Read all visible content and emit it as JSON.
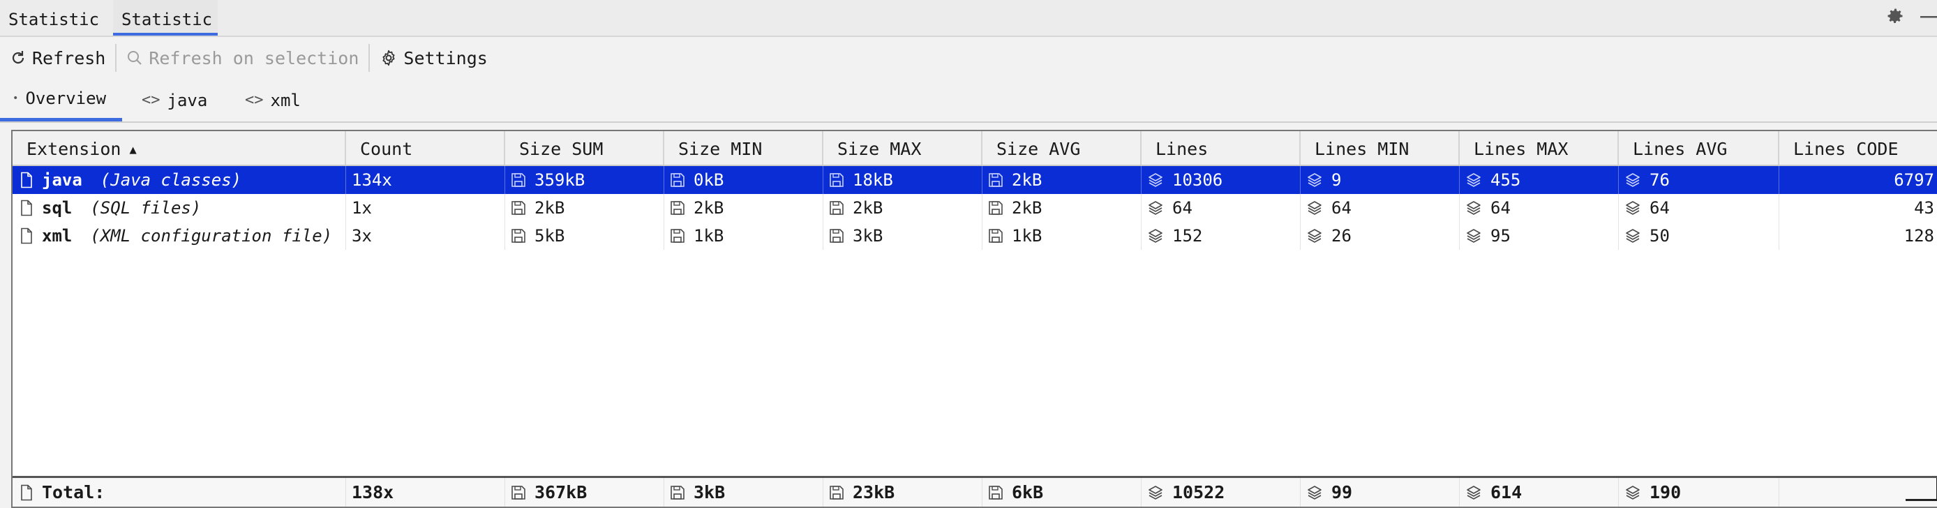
{
  "top_tabs": [
    "Statistic",
    "Statistic"
  ],
  "toolbar": {
    "refresh": "Refresh",
    "refresh_selection": "Refresh on selection",
    "settings": "Settings"
  },
  "sub_tabs": [
    "Overview",
    "java",
    "xml"
  ],
  "columns": [
    "Extension",
    "Count",
    "Size SUM",
    "Size MIN",
    "Size MAX",
    "Size AVG",
    "Lines",
    "Lines MIN",
    "Lines MAX",
    "Lines AVG",
    "Lines CODE"
  ],
  "sort": {
    "column": "Extension",
    "direction": "ascending"
  },
  "rows": [
    {
      "ext": "java",
      "desc": "(Java classes)",
      "count": "134x",
      "size_sum": "359kB",
      "size_min": "0kB",
      "size_max": "18kB",
      "size_avg": "2kB",
      "lines": "10306",
      "lines_min": "9",
      "lines_max": "455",
      "lines_avg": "76",
      "lines_code": "6797",
      "selected": true
    },
    {
      "ext": "sql",
      "desc": "(SQL files)",
      "count": "1x",
      "size_sum": "2kB",
      "size_min": "2kB",
      "size_max": "2kB",
      "size_avg": "2kB",
      "lines": "64",
      "lines_min": "64",
      "lines_max": "64",
      "lines_avg": "64",
      "lines_code": "43",
      "selected": false
    },
    {
      "ext": "xml",
      "desc": "(XML configuration file)",
      "count": "3x",
      "size_sum": "5kB",
      "size_min": "1kB",
      "size_max": "3kB",
      "size_avg": "1kB",
      "lines": "152",
      "lines_min": "26",
      "lines_max": "95",
      "lines_avg": "50",
      "lines_code": "128",
      "selected": false
    }
  ],
  "total": {
    "label": "Total:",
    "count": "138x",
    "size_sum": "367kB",
    "size_min": "3kB",
    "size_max": "23kB",
    "size_avg": "6kB",
    "lines": "10522",
    "lines_min": "99",
    "lines_max": "614",
    "lines_avg": "190"
  },
  "colors": {
    "selection": "#0b2dd6",
    "accent": "#3d6ce0"
  }
}
